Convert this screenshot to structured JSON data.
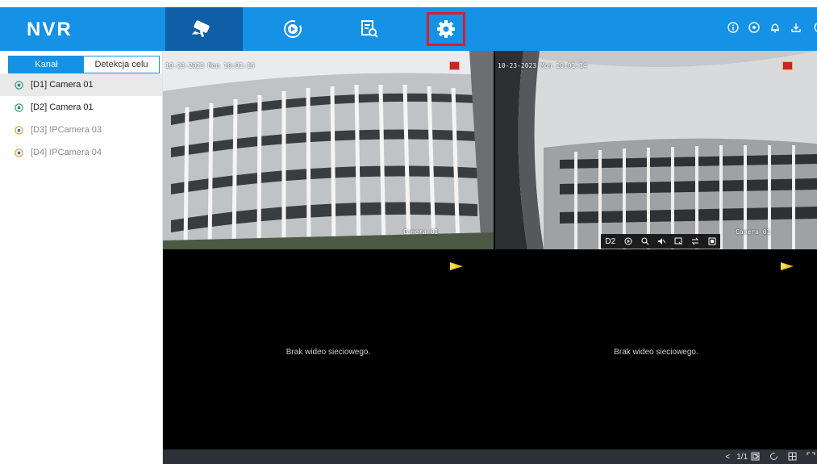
{
  "app": {
    "logo": "NVR"
  },
  "nav": {
    "tabs": [
      {
        "name": "live-view",
        "icon": "camera-icon"
      },
      {
        "name": "playback",
        "icon": "playback-icon"
      },
      {
        "name": "search",
        "icon": "search-icon"
      },
      {
        "name": "configuration",
        "icon": "gear-icon"
      }
    ],
    "right_icons": [
      "info-icon",
      "target-icon",
      "bell-icon",
      "download-icon",
      "power-icon"
    ]
  },
  "sidebar": {
    "tabs": [
      "Kanał",
      "Detekcja celu"
    ],
    "cameras": [
      {
        "label": "[D1] Camera 01",
        "status": "online"
      },
      {
        "label": "[D2] Camera 01",
        "status": "online"
      },
      {
        "label": "[D3] IPCamera 03",
        "status": "offline"
      },
      {
        "label": "[D4] IPCamera 04",
        "status": "offline"
      }
    ]
  },
  "grid": {
    "cell1": {
      "timestamp": "10-23-2023 Mon 10:01:15",
      "name": "Camera 01"
    },
    "cell2": {
      "timestamp": "10-23-2023 Mon 10:01:14",
      "name": "Camera 01",
      "controls_label": "D2"
    },
    "cell3": {
      "message": "Brak wideo sieciowego."
    },
    "cell4": {
      "message": "Brak wideo sieciowego."
    }
  },
  "bottom": {
    "page": "1/1",
    "prev": "<",
    "next": ">"
  },
  "colors": {
    "accent": "#1591e6",
    "active_tab": "#0e5fa6",
    "highlight": "#d61f2b"
  }
}
